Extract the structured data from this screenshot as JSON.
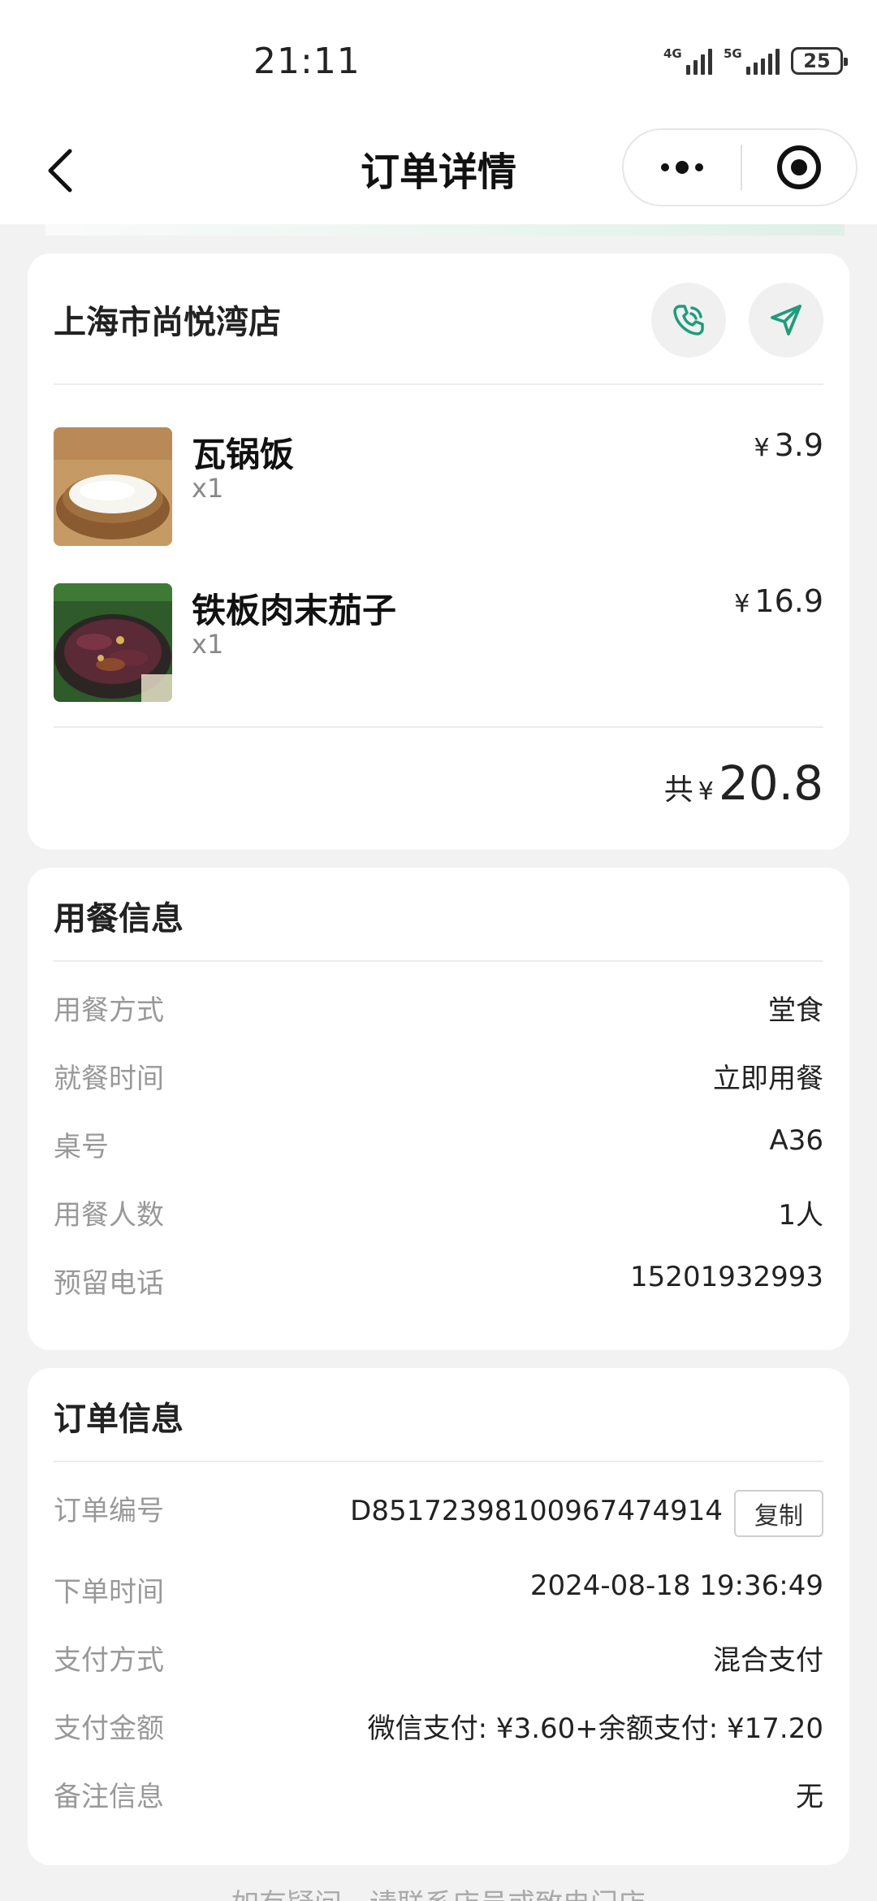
{
  "status_bar": {
    "time": "21:11",
    "signal_1": "4G",
    "signal_2": "5G",
    "battery": "25"
  },
  "nav": {
    "title": "订单详情"
  },
  "store": {
    "name": "上海市尚悦湾店",
    "items": [
      {
        "name": "瓦锅饭",
        "qty": "x1",
        "currency": "¥",
        "price": "3.9"
      },
      {
        "name": "铁板肉末茄子",
        "qty": "x1",
        "currency": "¥",
        "price": "16.9"
      }
    ],
    "total_label": "共",
    "total_currency": "¥",
    "total_amount": "20.8"
  },
  "dining": {
    "title": "用餐信息",
    "rows": [
      {
        "label": "用餐方式",
        "value": "堂食"
      },
      {
        "label": "就餐时间",
        "value": "立即用餐"
      },
      {
        "label": "桌号",
        "value": "A36"
      },
      {
        "label": "用餐人数",
        "value": "1人"
      },
      {
        "label": "预留电话",
        "value": "15201932993"
      }
    ]
  },
  "order": {
    "title": "订单信息",
    "number_label": "订单编号",
    "number_value": "D85172398100967474914",
    "copy_label": "复制",
    "rows": [
      {
        "label": "下单时间",
        "value": "2024-08-18 19:36:49"
      },
      {
        "label": "支付方式",
        "value": "混合支付"
      },
      {
        "label": "支付金额",
        "value": "微信支付: ¥3.60+余额支付: ¥17.20"
      },
      {
        "label": "备注信息",
        "value": "无"
      }
    ]
  },
  "footer": {
    "text": "如有疑问，请联系店员或致电门店"
  },
  "colors": {
    "accent": "#1e9c7c",
    "background": "#f2f2f2",
    "card": "#ffffff"
  },
  "icons": {
    "back": "chevron-left-icon",
    "more": "more-dots-icon",
    "close": "mini-program-close-icon",
    "phone": "phone-icon",
    "navigate": "navigation-arrow-icon"
  }
}
